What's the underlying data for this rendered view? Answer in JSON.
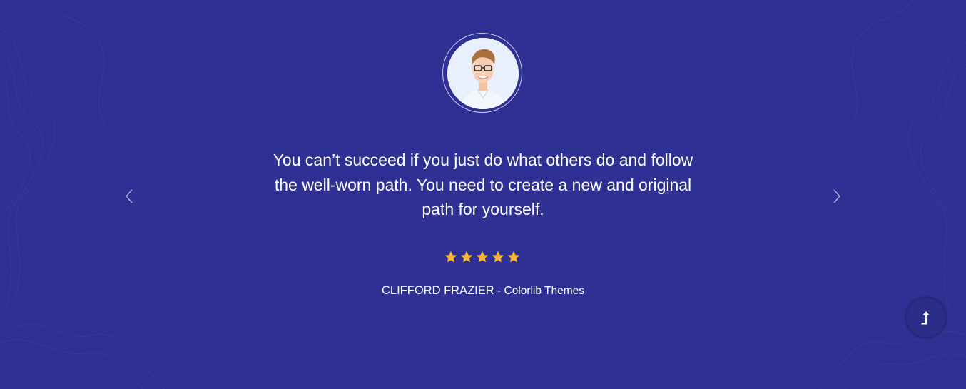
{
  "testimonial": {
    "quote": "You can’t succeed if you just do what others do and follow the well-worn path. You need to create a new and original path for yourself.",
    "rating": 5,
    "rating_max": 5,
    "author_name": "CLIFFORD FRAZIER",
    "author_separator": " - ",
    "author_company": "Colorlib Themes"
  },
  "navigation": {
    "prev_icon": "chevron-left-icon",
    "next_icon": "chevron-right-icon"
  },
  "scroll_top": {
    "icon": "arrow-up-icon"
  },
  "colors": {
    "background": "#2e3093",
    "star": "#f7b731",
    "text": "#ffffff"
  }
}
